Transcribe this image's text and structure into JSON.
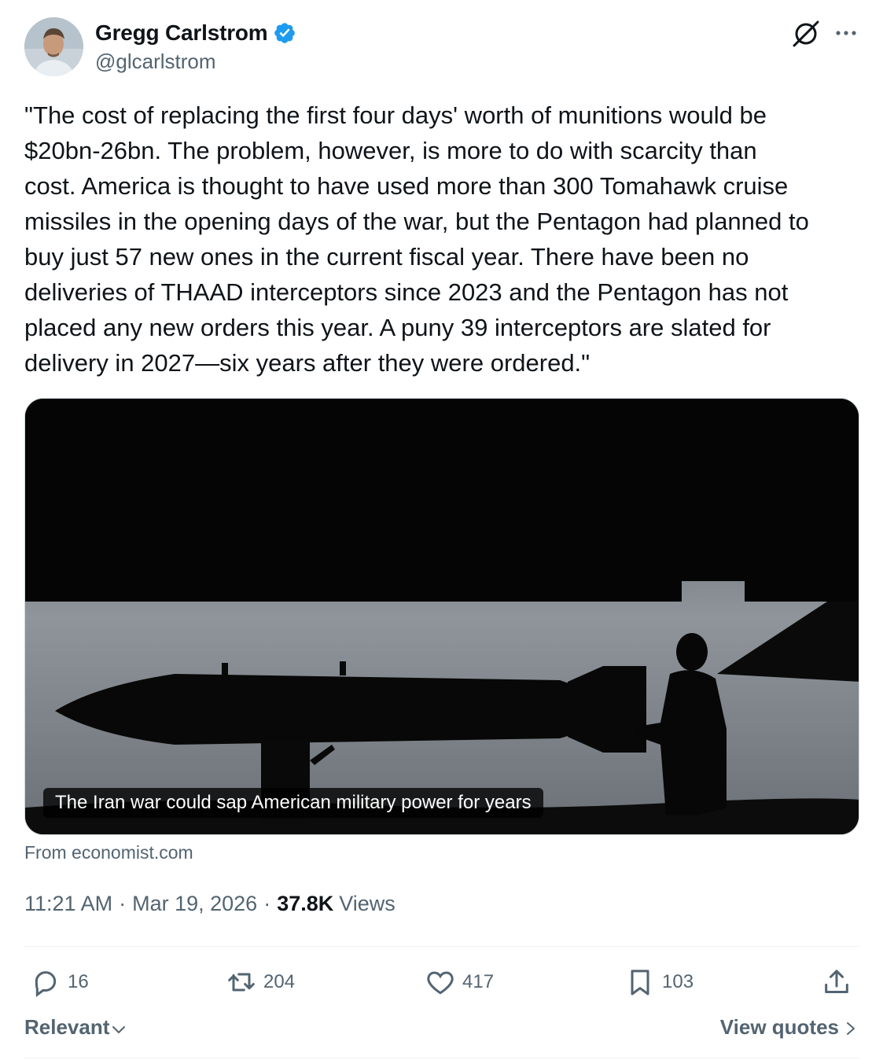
{
  "author": {
    "name": "Gregg Carlstrom",
    "handle": "@glcarlstrom",
    "verified": true
  },
  "tweet": {
    "text": "\"The cost of replacing the first four days' worth of munitions would be\n$20bn-26bn. The problem, however, is more to do with scarcity than\ncost. America is thought to have used more than 300 Tomahawk cruise\nmissiles in the opening days of the war, but the Pentagon had planned to\nbuy just 57 new ones in the current fiscal year. There have been no\ndeliveries of THAAD interceptors since 2023 and the Pentagon has not\nplaced any new orders this year. A puny 39 interceptors are slated for\ndelivery in 2027—six years after they were ordered.\""
  },
  "card": {
    "caption": "The Iran war could sap American military power for years",
    "source": "From economist.com"
  },
  "meta": {
    "time": "11:21 AM",
    "date": "Mar 19, 2026",
    "separator": "·",
    "views_count": "37.8K",
    "views_label": "Views"
  },
  "actions": {
    "replies": "16",
    "retweets": "204",
    "likes": "417",
    "bookmarks": "103"
  },
  "footer": {
    "sort_label": "Relevant",
    "view_quotes": "View quotes"
  },
  "icons": {
    "verified": "verified-badge-icon",
    "grok": "grok-icon",
    "more": "more-icon",
    "reply": "reply-icon",
    "retweet": "retweet-icon",
    "like": "heart-icon",
    "bookmark": "bookmark-icon",
    "share": "share-icon"
  },
  "colors": {
    "verified_blue": "#1d9bf0",
    "text_primary": "#0f1419",
    "text_secondary": "#536471",
    "divider": "#eff3f4"
  }
}
